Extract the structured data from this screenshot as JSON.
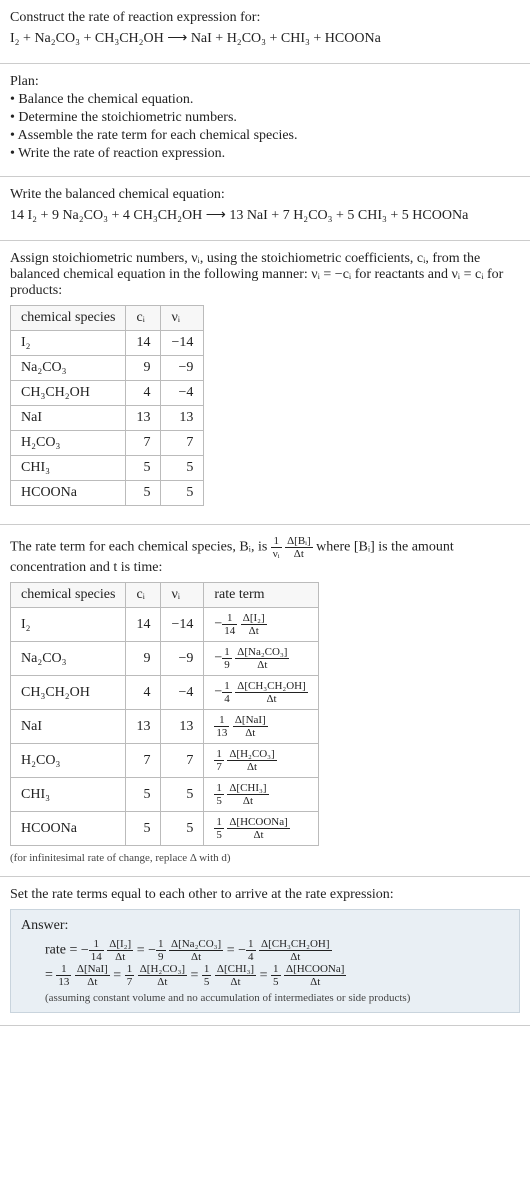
{
  "intro": {
    "title": "Construct the rate of reaction expression for:",
    "equation": "I₂ + Na₂CO₃ + CH₃CH₂OH ⟶ NaI + H₂CO₃ + CHI₃ + HCOONa"
  },
  "plan": {
    "heading": "Plan:",
    "items": [
      "• Balance the chemical equation.",
      "• Determine the stoichiometric numbers.",
      "• Assemble the rate term for each chemical species.",
      "• Write the rate of reaction expression."
    ]
  },
  "balanced": {
    "heading": "Write the balanced chemical equation:",
    "equation": "14 I₂ + 9 Na₂CO₃ + 4 CH₃CH₂OH ⟶ 13 NaI + 7 H₂CO₃ + 5 CHI₃ + 5 HCOONa"
  },
  "stoich": {
    "intro1": "Assign stoichiometric numbers, νᵢ, using the stoichiometric coefficients, cᵢ, from the balanced chemical equation in the following manner: νᵢ = −cᵢ for reactants and νᵢ = cᵢ for products:",
    "headers": [
      "chemical species",
      "cᵢ",
      "νᵢ"
    ],
    "rows": [
      {
        "species": "I₂",
        "c": "14",
        "v": "−14"
      },
      {
        "species": "Na₂CO₃",
        "c": "9",
        "v": "−9"
      },
      {
        "species": "CH₃CH₂OH",
        "c": "4",
        "v": "−4"
      },
      {
        "species": "NaI",
        "c": "13",
        "v": "13"
      },
      {
        "species": "H₂CO₃",
        "c": "7",
        "v": "7"
      },
      {
        "species": "CHI₃",
        "c": "5",
        "v": "5"
      },
      {
        "species": "HCOONa",
        "c": "5",
        "v": "5"
      }
    ]
  },
  "rateterm": {
    "intro_a": "The rate term for each chemical species, Bᵢ, is ",
    "intro_frac_num": "1",
    "intro_frac_den": "νᵢ",
    "intro_frac2_num": "Δ[Bᵢ]",
    "intro_frac2_den": "Δt",
    "intro_b": " where [Bᵢ] is the amount concentration and t is time:",
    "headers": [
      "chemical species",
      "cᵢ",
      "νᵢ",
      "rate term"
    ],
    "rows": [
      {
        "species": "I₂",
        "c": "14",
        "v": "−14",
        "sign": "−",
        "d": "14",
        "dn": "Δ[I₂]"
      },
      {
        "species": "Na₂CO₃",
        "c": "9",
        "v": "−9",
        "sign": "−",
        "d": "9",
        "dn": "Δ[Na₂CO₃]"
      },
      {
        "species": "CH₃CH₂OH",
        "c": "4",
        "v": "−4",
        "sign": "−",
        "d": "4",
        "dn": "Δ[CH₃CH₂OH]"
      },
      {
        "species": "NaI",
        "c": "13",
        "v": "13",
        "sign": "",
        "d": "13",
        "dn": "Δ[NaI]"
      },
      {
        "species": "H₂CO₃",
        "c": "7",
        "v": "7",
        "sign": "",
        "d": "7",
        "dn": "Δ[H₂CO₃]"
      },
      {
        "species": "CHI₃",
        "c": "5",
        "v": "5",
        "sign": "",
        "d": "5",
        "dn": "Δ[CHI₃]"
      },
      {
        "species": "HCOONa",
        "c": "5",
        "v": "5",
        "sign": "",
        "d": "5",
        "dn": "Δ[HCOONa]"
      }
    ],
    "footnote": "(for infinitesimal rate of change, replace Δ with d)"
  },
  "final": {
    "heading": "Set the rate terms equal to each other to arrive at the rate expression:",
    "answer_label": "Answer:",
    "rate_label": "rate = ",
    "terms_line1": [
      {
        "sign": "−",
        "d": "14",
        "dn": "Δ[I₂]"
      },
      {
        "sign": "−",
        "d": "9",
        "dn": "Δ[Na₂CO₃]"
      },
      {
        "sign": "−",
        "d": "4",
        "dn": "Δ[CH₃CH₂OH]"
      }
    ],
    "terms_line2": [
      {
        "sign": "",
        "d": "13",
        "dn": "Δ[NaI]"
      },
      {
        "sign": "",
        "d": "7",
        "dn": "Δ[H₂CO₃]"
      },
      {
        "sign": "",
        "d": "5",
        "dn": "Δ[CHI₃]"
      },
      {
        "sign": "",
        "d": "5",
        "dn": "Δ[HCOONa]"
      }
    ],
    "assumption": "(assuming constant volume and no accumulation of intermediates or side products)"
  }
}
